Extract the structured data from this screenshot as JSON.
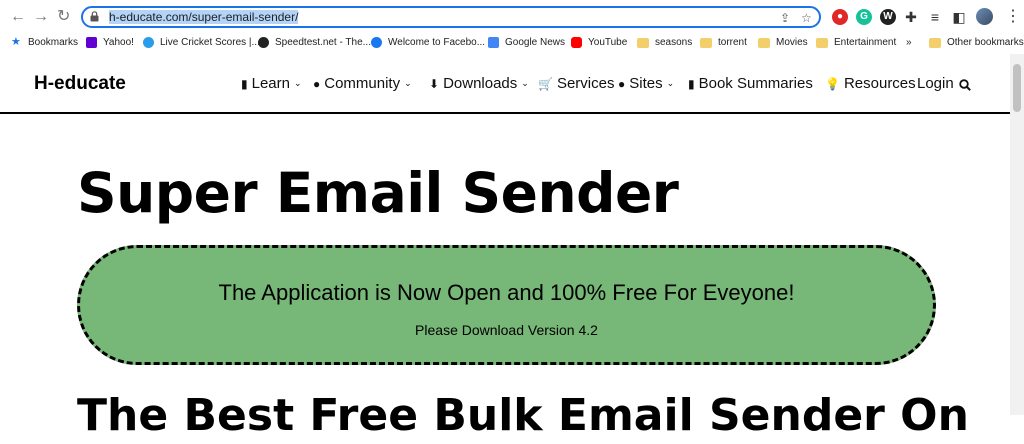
{
  "browser": {
    "url_domain": "h-educate.com",
    "url_path": "/super-email-sender/",
    "ext_colors": {
      "adblock": "#e02828",
      "grammarly": "#15c39a"
    }
  },
  "bookmarks": [
    {
      "label": "Bookmarks",
      "icon": "star-icon"
    },
    {
      "label": "Yahoo!",
      "icon": "yahoo-icon"
    },
    {
      "label": "Live Cricket Scores |...",
      "icon": "globe-icon"
    },
    {
      "label": "Speedtest.net - The...",
      "icon": "speedtest-icon"
    },
    {
      "label": "Welcome to Facebo...",
      "icon": "facebook-icon"
    },
    {
      "label": "Google News",
      "icon": "google-news-icon"
    },
    {
      "label": "YouTube",
      "icon": "youtube-icon"
    },
    {
      "label": "seasons",
      "icon": "folder-icon"
    },
    {
      "label": "torrent",
      "icon": "folder-icon"
    },
    {
      "label": "Movies",
      "icon": "folder-icon"
    },
    {
      "label": "Entertainment",
      "icon": "folder-icon"
    },
    {
      "label": "»",
      "icon": ""
    },
    {
      "label": "Other bookmarks",
      "icon": "folder-icon"
    }
  ],
  "site": {
    "logo": "H-educate",
    "nav": [
      {
        "label": "Learn",
        "icon": "book-icon",
        "dropdown": true
      },
      {
        "label": "Community",
        "icon": "globe-icon",
        "dropdown": true
      },
      {
        "label": "Downloads",
        "icon": "download-icon",
        "dropdown": true
      },
      {
        "label": "Services",
        "icon": "cart-icon",
        "dropdown": false
      },
      {
        "label": "Sites",
        "icon": "globe-icon",
        "dropdown": true
      },
      {
        "label": "Book Summaries",
        "icon": "book-icon",
        "dropdown": false
      },
      {
        "label": "Resources",
        "icon": "bulb-icon",
        "dropdown": false
      },
      {
        "label": "Login",
        "icon": "",
        "dropdown": false
      }
    ]
  },
  "content": {
    "title": "Super Email Sender",
    "banner_main": "The Application is Now Open and 100% Free For Eveyone!",
    "banner_sub": "Please Download Version 4.2",
    "banner_color": "#77b777",
    "subheading": "The Best Free Bulk Email Sender On"
  }
}
